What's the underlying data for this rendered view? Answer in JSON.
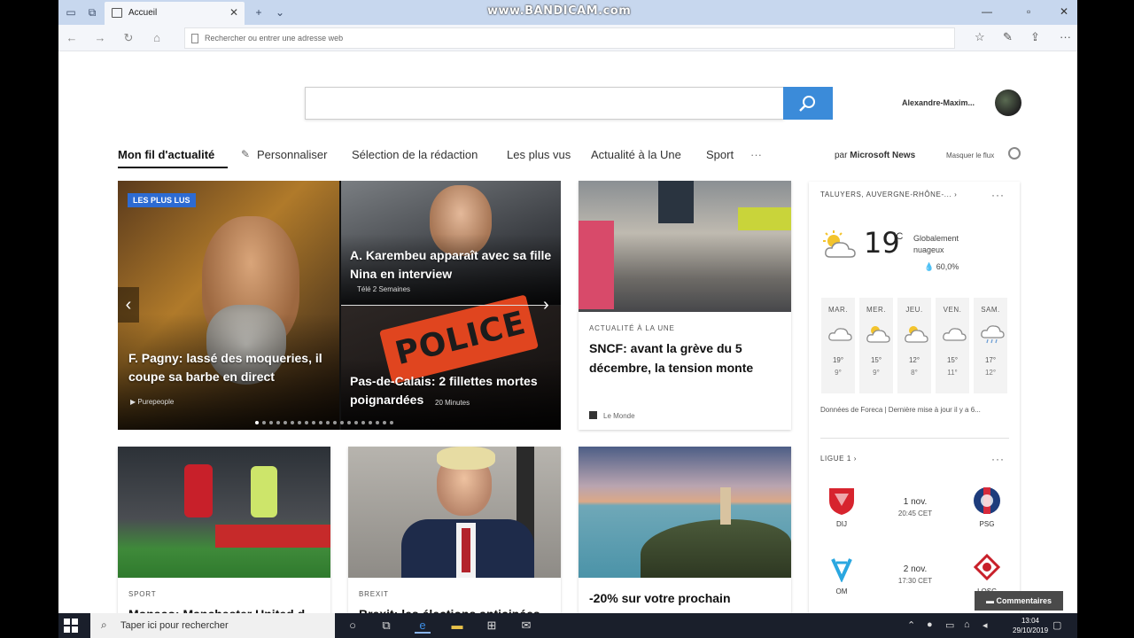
{
  "browser": {
    "tab_title": "Accueil",
    "address_placeholder": "Rechercher ou entrer une adresse web",
    "watermark": "www.BANDICAM.com"
  },
  "page": {
    "search_placeholder": "",
    "user_name": "Alexandre-Maxim...",
    "nav_tabs": [
      "Mon fil d'actualité",
      "Personnaliser",
      "Sélection de la rédaction",
      "Les plus vus",
      "Actualité à la Une",
      "Sport",
      "···"
    ],
    "par_label": "par",
    "provider": "Microsoft News",
    "hide_feed": "Masquer le flux"
  },
  "hero": {
    "badge": "LES PLUS LUS",
    "left_title": "F. Pagny: lassé des moqueries, il coupe sa barbe en direct",
    "left_source": "Purepeople",
    "right_top_title": "A. Karembeu apparaît avec sa fille Nina en interview",
    "right_top_meta": "Télé 2 Semaines",
    "right_bottom_title": "Pas-de-Calais: 2 fillettes mortes poignardées",
    "right_bottom_meta": "20 Minutes",
    "police_text": "POLICE",
    "slide_count": 20,
    "active_slide": 0
  },
  "cards": [
    {
      "category": "ACTUALITÉ À LA UNE",
      "title": "SNCF: avant la grève du 5 décembre, la tension monte",
      "source": "Le Monde"
    },
    {
      "category": "SPORT",
      "title": "Monaco: Manchester United d..."
    },
    {
      "category": "BREXIT",
      "title": "Brexit: les élections anticipées..."
    },
    {
      "category": "",
      "title": "-20% sur votre prochain"
    }
  ],
  "weather": {
    "location": "TALUYERS, AUVERGNE-RHÔNE-...",
    "more": "···",
    "temperature": "19",
    "unit": "°C",
    "condition": "Globalement nuageux",
    "rain": "60,0%",
    "days": [
      {
        "name": "MAR.",
        "hi": "19°",
        "lo": "9°",
        "icon": "cloud-icon"
      },
      {
        "name": "MER.",
        "hi": "15°",
        "lo": "9°",
        "icon": "sun-cloud-icon"
      },
      {
        "name": "JEU.",
        "hi": "12°",
        "lo": "8°",
        "icon": "sun-cloud-icon"
      },
      {
        "name": "VEN.",
        "hi": "15°",
        "lo": "11°",
        "icon": "cloud-icon"
      },
      {
        "name": "SAM.",
        "hi": "17°",
        "lo": "12°",
        "icon": "rain-cloud-icon"
      }
    ],
    "footer": "Données de Foreca | Dernière mise à jour il y a 6..."
  },
  "league": {
    "title": "LIGUE 1",
    "matches": [
      {
        "home": "DIJ",
        "away": "PSG",
        "date": "1 nov.",
        "time": "20:45 CET"
      },
      {
        "home": "OM",
        "away": "LOSC",
        "date": "2 nov.",
        "time": "17:30 CET"
      }
    ]
  },
  "comments_button": "Commentaires",
  "taskbar": {
    "search_placeholder": "Taper ici pour rechercher",
    "time": "13:04",
    "date": "29/10/2019"
  },
  "colors": {
    "accent": "#3b8bd9",
    "badge": "#2d6bd3",
    "titlebar": "#c7d7ee",
    "taskbar": "#1a1f2b"
  }
}
